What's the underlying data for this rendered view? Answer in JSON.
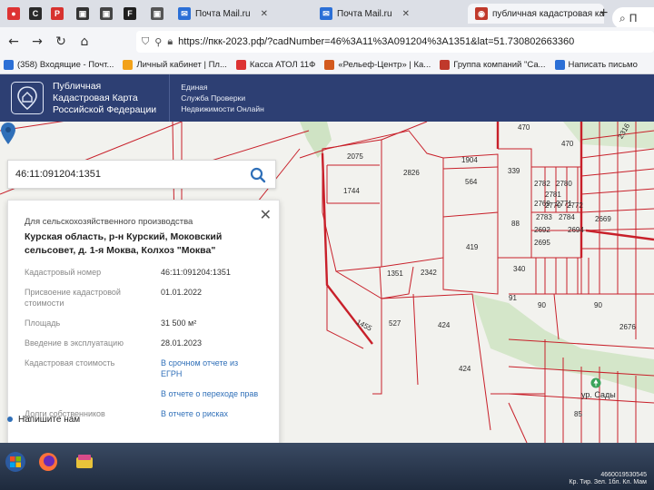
{
  "browser": {
    "tabs": [
      {
        "label": "Почта Mail.ru",
        "icon": "mail-icon",
        "color": "#2b6fd6"
      },
      {
        "label": "Почта Mail.ru",
        "icon": "mail-icon",
        "color": "#2b6fd6"
      },
      {
        "label": "публичная кадастровая карта",
        "icon": "cadastral-icon",
        "color": "#c0392b",
        "active": true
      }
    ],
    "address": "https://пкк-2023.рф/?cadNumber=46%3A11%3A091204%3A1351&lat=51.730802663360",
    "bookmarks": [
      {
        "label": "(358) Входящие - Почт...",
        "color": "#2b6fd6"
      },
      {
        "label": "Личный кабинет | Пл...",
        "color": "#f2a21b"
      },
      {
        "label": "Касса АТОЛ 11Ф",
        "color": "#d33"
      },
      {
        "label": "«Рельеф-Центр» | Ка...",
        "color": "#d35a1e"
      },
      {
        "label": "Группа компаний \"Са...",
        "color": "#c0392b"
      },
      {
        "label": "Написать письмо",
        "color": "#2b6fd6"
      }
    ]
  },
  "header": {
    "brand_line1": "Публичная",
    "brand_line2": "Кадастровая Карта",
    "brand_line3": "Российской Федерации",
    "service_line1": "Единая",
    "service_line2": "Служба Проверки",
    "service_line3": "Недвижимости Онлайн"
  },
  "search": {
    "value": "46:11:091204:1351"
  },
  "card": {
    "category": "Для сельскохозяйственного производства",
    "address": "Курская область, р-н Курский, Моковский сельсовет, д. 1-я Моква, Колхоз \"Моква\"",
    "rows": [
      {
        "key": "Кадастровый номер",
        "value": "46:11:091204:1351"
      },
      {
        "key": "Присвоение кадастровой стоимости",
        "value": "01.01.2022"
      },
      {
        "key": "Площадь",
        "value": "31 500 м²"
      },
      {
        "key": "Введение в эксплуатацию",
        "value": "28.01.2023"
      },
      {
        "key": "Кадастровая стоимость",
        "value": "В срочном отчете из ЕГРН"
      },
      {
        "key": "",
        "value": "В отчете о переходе прав"
      },
      {
        "key": "Долги собственников",
        "value": "В отчете о рисках"
      }
    ]
  },
  "chat": {
    "label": "Напишите нам"
  },
  "map": {
    "parcels": [
      "2075",
      "2826",
      "1904",
      "470",
      "470",
      "564",
      "339",
      "1744",
      "88",
      "419",
      "340",
      "1351",
      "2342",
      "527",
      "424",
      "424",
      "90",
      "90",
      "91",
      "85",
      "2783",
      "2784",
      "2669",
      "2692",
      "2694",
      "2695",
      "2782",
      "2781",
      "2780",
      "2769",
      "2770",
      "2771",
      "2772",
      "2676",
      "1455",
      "2316"
    ],
    "place": "ур. Сады"
  },
  "tray": {
    "line1": "4660019530545",
    "line2": "Кр. Тир. Зел. 1бл. Кл. Мам"
  },
  "colors": {
    "header_bg": "#2d3f73",
    "parcel_line": "#c8202a",
    "link": "#2f6fb8"
  }
}
